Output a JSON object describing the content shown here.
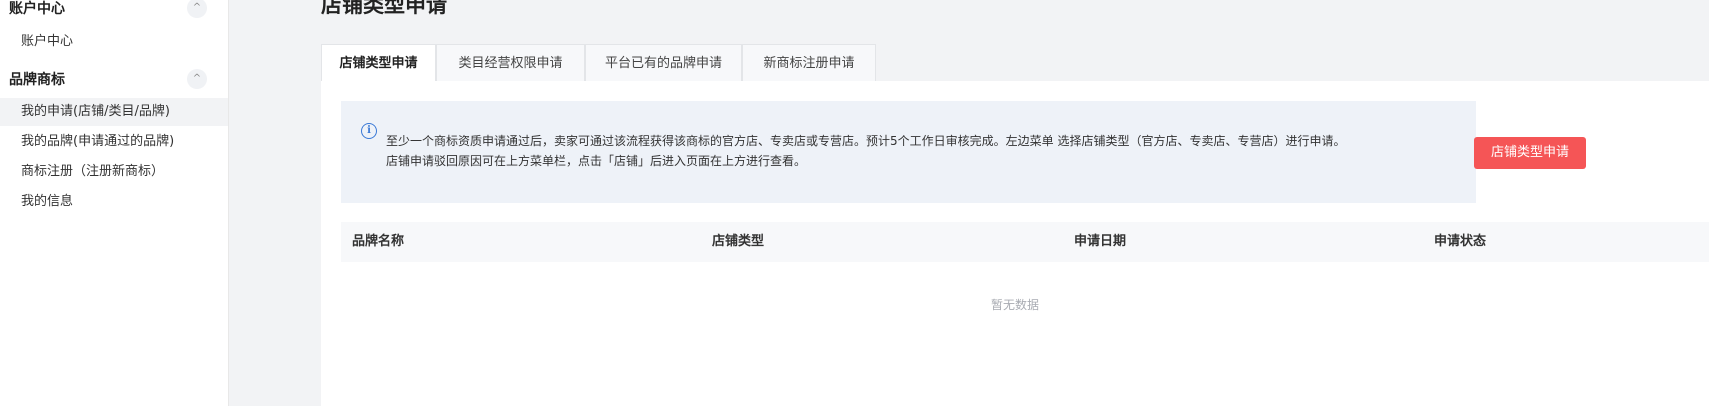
{
  "sidebar": {
    "account_group": {
      "title": "账户中心",
      "toggle": "^"
    },
    "account_items": [
      {
        "label": "账户中心"
      }
    ],
    "brand_group": {
      "title": "品牌商标",
      "toggle": "^"
    },
    "brand_items": [
      {
        "label": "我的申请(店铺/类目/品牌)",
        "active": true
      },
      {
        "label": "我的品牌(申请通过的品牌)",
        "active": false
      },
      {
        "label": "商标注册（注册新商标）",
        "active": false
      },
      {
        "label": "我的信息",
        "active": false
      }
    ]
  },
  "main": {
    "title": "店铺类型申请",
    "tabs": [
      {
        "label": "店铺类型申请",
        "active": true
      },
      {
        "label": "类目经营权限申请",
        "active": false
      },
      {
        "label": "平台已有的品牌申请",
        "active": false
      },
      {
        "label": "新商标注册申请",
        "active": false
      }
    ],
    "notice": {
      "icon": "info-icon",
      "line1": "至少一个商标资质申请通过后，卖家可通过该流程获得该商标的官方店、专卖店或专营店。预计5个工作日审核完成。左边菜单 选择店铺类型（官方店、专卖店、专营店）进行申请。",
      "line2": "店铺申请驳回原因可在上方菜单栏，点击「店铺」后进入页面在上方进行查看。"
    },
    "apply_button": "店铺类型申请",
    "table": {
      "columns": [
        "品牌名称",
        "店铺类型",
        "申请日期",
        "申请状态"
      ],
      "rows": [],
      "empty_text": "暂无数据"
    }
  },
  "colors": {
    "primary": "#f55556",
    "info": "#3a79d6",
    "notice_bg": "#eef2f8",
    "page_bg": "#f2f3f5"
  }
}
